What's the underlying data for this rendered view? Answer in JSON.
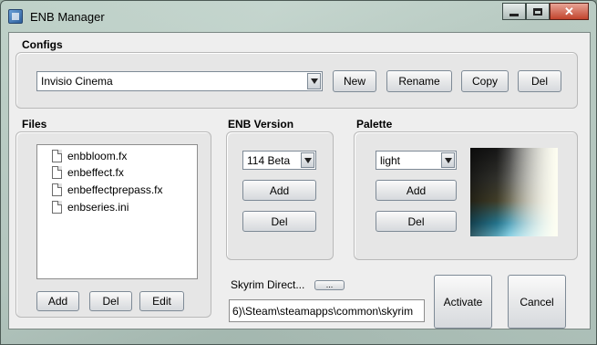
{
  "window": {
    "title": "ENB Manager",
    "close_glyph": "✕"
  },
  "configs": {
    "label": "Configs",
    "selected": "Invisio Cinema",
    "buttons": {
      "new": "New",
      "rename": "Rename",
      "copy": "Copy",
      "del": "Del"
    }
  },
  "files": {
    "label": "Files",
    "items": [
      "enbbloom.fx",
      "enbeffect.fx",
      "enbeffectprepass.fx",
      "enbseries.ini"
    ],
    "buttons": {
      "add": "Add",
      "del": "Del",
      "edit": "Edit"
    }
  },
  "enb_version": {
    "label": "ENB Version",
    "selected": "114 Beta",
    "buttons": {
      "add": "Add",
      "del": "Del"
    }
  },
  "palette": {
    "label": "Palette",
    "selected": "light",
    "buttons": {
      "add": "Add",
      "del": "Del"
    }
  },
  "skyrim": {
    "label": "Skyrim Direct...",
    "browse": "...",
    "path": "6)\\Steam\\steamapps\\common\\skyrim"
  },
  "actions": {
    "activate": "Activate",
    "cancel": "Cancel"
  }
}
